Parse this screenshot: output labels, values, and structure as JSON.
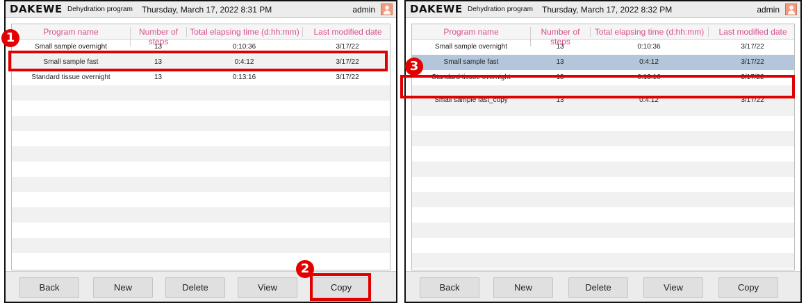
{
  "left": {
    "header": {
      "logo": "DAKEWE",
      "section": "Dehydration program",
      "datetime": "Thursday, March 17, 2022 8:31 PM",
      "user": "admin",
      "user_icon": "user-avatar-icon"
    },
    "table": {
      "columns": [
        "Program name",
        "Number of steps",
        "Total elapsing time (d:hh:mm)",
        "Last modified date"
      ],
      "rows": [
        {
          "name": "Small sample overnight",
          "steps": "13",
          "time": "0:10:36",
          "date": "3/17/22"
        },
        {
          "name": "Small sample fast",
          "steps": "13",
          "time": "0:4:12",
          "date": "3/17/22"
        },
        {
          "name": "Standard tissue overnight",
          "steps": "13",
          "time": "0:13:16",
          "date": "3/17/22"
        }
      ]
    },
    "buttons": {
      "back": "Back",
      "new": "New",
      "delete": "Delete",
      "view": "View",
      "copy": "Copy"
    }
  },
  "right": {
    "header": {
      "logo": "DAKEWE",
      "section": "Dehydration program",
      "datetime": "Thursday, March 17, 2022 8:32 PM",
      "user": "admin",
      "user_icon": "user-avatar-icon"
    },
    "table": {
      "columns": [
        "Program name",
        "Number of steps",
        "Total elapsing time (d:hh:mm)",
        "Last modified date"
      ],
      "rows": [
        {
          "name": "Small sample overnight",
          "steps": "13",
          "time": "0:10:36",
          "date": "3/17/22"
        },
        {
          "name": "Small sample fast",
          "steps": "13",
          "time": "0:4:12",
          "date": "3/17/22"
        },
        {
          "name": "Standard tissue overnight",
          "steps": "13",
          "time": "0:13:16",
          "date": "3/17/22"
        },
        {
          "name": "Small sample fast_copy",
          "steps": "13",
          "time": "0:4:12",
          "date": "3/17/22"
        }
      ]
    },
    "buttons": {
      "back": "Back",
      "new": "New",
      "delete": "Delete",
      "view": "View",
      "copy": "Copy"
    }
  },
  "annotations": {
    "step1": "1",
    "step2": "2",
    "step3": "3"
  },
  "colors": {
    "header_text": "#d8508f",
    "selected_row": "#b3c6dc",
    "highlight": "#e00000",
    "badge": "#e30000"
  }
}
